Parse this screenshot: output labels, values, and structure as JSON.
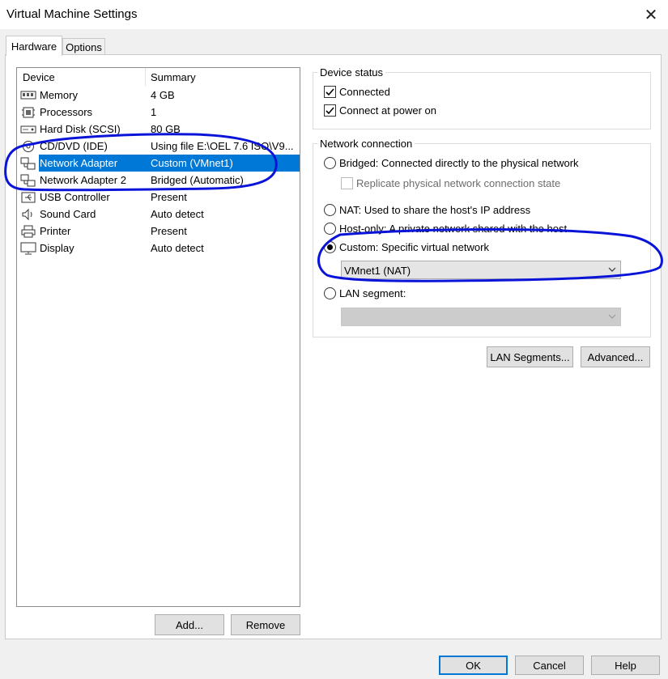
{
  "window": {
    "title": "Virtual Machine Settings"
  },
  "tabs": [
    {
      "label": "Hardware",
      "active": true
    },
    {
      "label": "Options",
      "active": false
    }
  ],
  "device_list": {
    "headers": {
      "device": "Device",
      "summary": "Summary"
    },
    "rows": [
      {
        "icon": "memory-icon",
        "name": "Memory",
        "summary": "4 GB",
        "selected": false
      },
      {
        "icon": "processor-icon",
        "name": "Processors",
        "summary": "1",
        "selected": false
      },
      {
        "icon": "hard-disk-icon",
        "name": "Hard Disk (SCSI)",
        "summary": "80 GB",
        "selected": false
      },
      {
        "icon": "cd-dvd-icon",
        "name": "CD/DVD (IDE)",
        "summary": "Using file E:\\OEL 7.6 ISO\\V9...",
        "selected": false
      },
      {
        "icon": "network-adapter-icon",
        "name": "Network Adapter",
        "summary": "Custom (VMnet1)",
        "selected": true
      },
      {
        "icon": "network-adapter-icon",
        "name": "Network Adapter 2",
        "summary": "Bridged (Automatic)",
        "selected": false
      },
      {
        "icon": "usb-icon",
        "name": "USB Controller",
        "summary": "Present",
        "selected": false
      },
      {
        "icon": "speaker-icon",
        "name": "Sound Card",
        "summary": "Auto detect",
        "selected": false
      },
      {
        "icon": "printer-icon",
        "name": "Printer",
        "summary": "Present",
        "selected": false
      },
      {
        "icon": "display-icon",
        "name": "Display",
        "summary": "Auto detect",
        "selected": false
      }
    ],
    "add_button": "Add...",
    "remove_button": "Remove"
  },
  "device_status": {
    "title": "Device status",
    "connected": {
      "label": "Connected",
      "checked": true
    },
    "connect_at_power_on": {
      "label": "Connect at power on",
      "checked": true
    }
  },
  "network_connection": {
    "title": "Network connection",
    "bridged": {
      "label": "Bridged: Connected directly to the physical network",
      "selected": false
    },
    "replicate": {
      "label": "Replicate physical network connection state",
      "checked": false,
      "enabled": false
    },
    "nat": {
      "label": "NAT: Used to share the host's IP address",
      "selected": false
    },
    "host_only": {
      "label": "Host-only: A private network shared with the host",
      "selected": false
    },
    "custom": {
      "label": "Custom: Specific virtual network",
      "selected": true
    },
    "custom_network": "VMnet1 (NAT)",
    "lan_segment": {
      "label": "LAN segment:",
      "selected": false
    },
    "lan_segment_value": ""
  },
  "buttons": {
    "lan_segments": "LAN Segments...",
    "advanced": "Advanced...",
    "ok": "OK",
    "cancel": "Cancel",
    "help": "Help"
  },
  "colors": {
    "selection": "#0078d7",
    "annotation": "#0a14d8"
  }
}
